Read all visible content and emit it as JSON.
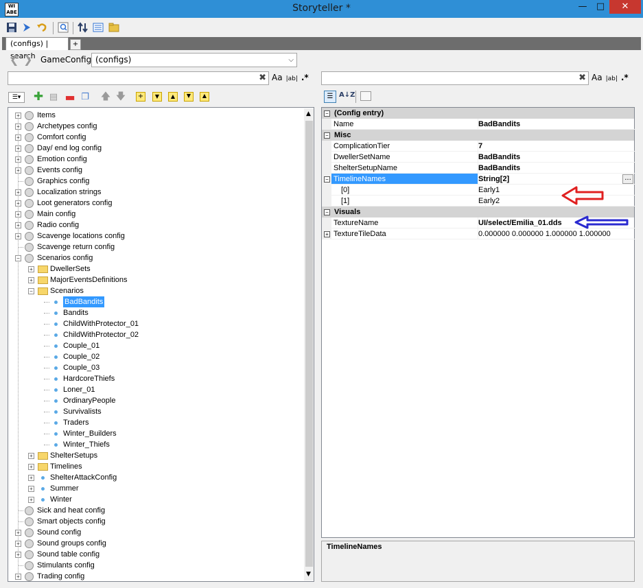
{
  "window": {
    "title": "Storyteller *",
    "app_icon_text": "WI\nABE"
  },
  "tabs": [
    {
      "label": "(configs) | search"
    }
  ],
  "tab_add_label": "+",
  "gameconfig": {
    "label": "GameConfig:",
    "value": "(configs)"
  },
  "search": {
    "left": {
      "value": "",
      "opts": [
        "Aa",
        "|ab|",
        ".*"
      ]
    },
    "right": {
      "value": "",
      "opts": [
        "Aa",
        "|ab|",
        ".*"
      ]
    }
  },
  "tree": [
    {
      "label": "Items",
      "icon": "gear",
      "expandable": true,
      "level": 0
    },
    {
      "label": "Archetypes config",
      "icon": "gear",
      "expandable": true,
      "level": 0
    },
    {
      "label": "Comfort config",
      "icon": "gear",
      "expandable": true,
      "level": 0
    },
    {
      "label": "Day/ end log config",
      "icon": "gear",
      "expandable": true,
      "level": 0
    },
    {
      "label": "Emotion config",
      "icon": "gear",
      "expandable": true,
      "level": 0
    },
    {
      "label": "Events config",
      "icon": "gear",
      "expandable": true,
      "level": 0
    },
    {
      "label": "Graphics config",
      "icon": "gear",
      "expandable": false,
      "level": 0
    },
    {
      "label": "Localization strings",
      "icon": "gear",
      "expandable": true,
      "level": 0
    },
    {
      "label": "Loot generators config",
      "icon": "gear",
      "expandable": true,
      "level": 0
    },
    {
      "label": "Main config",
      "icon": "gear",
      "expandable": true,
      "level": 0
    },
    {
      "label": "Radio config",
      "icon": "gear",
      "expandable": true,
      "level": 0
    },
    {
      "label": "Scavenge locations config",
      "icon": "gear",
      "expandable": true,
      "level": 0
    },
    {
      "label": "Scavenge return config",
      "icon": "gear",
      "expandable": false,
      "level": 0
    },
    {
      "label": "Scenarios config",
      "icon": "gear",
      "expandable": true,
      "expanded": true,
      "level": 0
    },
    {
      "label": "DwellerSets",
      "icon": "folder",
      "expandable": true,
      "level": 1
    },
    {
      "label": "MajorEventsDefinitions",
      "icon": "folder",
      "expandable": true,
      "level": 1
    },
    {
      "label": "Scenarios",
      "icon": "folder",
      "expandable": true,
      "expanded": true,
      "level": 1
    },
    {
      "label": "BadBandits",
      "icon": "dot",
      "expandable": false,
      "level": 2,
      "selected": true
    },
    {
      "label": "Bandits",
      "icon": "dot",
      "expandable": false,
      "level": 2
    },
    {
      "label": "ChildWithProtector_01",
      "icon": "dot",
      "expandable": false,
      "level": 2
    },
    {
      "label": "ChildWithProtector_02",
      "icon": "dot",
      "expandable": false,
      "level": 2
    },
    {
      "label": "Couple_01",
      "icon": "dot",
      "expandable": false,
      "level": 2
    },
    {
      "label": "Couple_02",
      "icon": "dot",
      "expandable": false,
      "level": 2
    },
    {
      "label": "Couple_03",
      "icon": "dot",
      "expandable": false,
      "level": 2
    },
    {
      "label": "HardcoreThiefs",
      "icon": "dot",
      "expandable": false,
      "level": 2
    },
    {
      "label": "Loner_01",
      "icon": "dot",
      "expandable": false,
      "level": 2
    },
    {
      "label": "OrdinaryPeople",
      "icon": "dot",
      "expandable": false,
      "level": 2
    },
    {
      "label": "Survivalists",
      "icon": "dot",
      "expandable": false,
      "level": 2
    },
    {
      "label": "Traders",
      "icon": "dot",
      "expandable": false,
      "level": 2
    },
    {
      "label": "Winter_Builders",
      "icon": "dot",
      "expandable": false,
      "level": 2
    },
    {
      "label": "Winter_Thiefs",
      "icon": "dot",
      "expandable": false,
      "level": 2
    },
    {
      "label": "ShelterSetups",
      "icon": "folder",
      "expandable": true,
      "level": 1
    },
    {
      "label": "Timelines",
      "icon": "folder",
      "expandable": true,
      "level": 1
    },
    {
      "label": "ShelterAttackConfig",
      "icon": "dot",
      "expandable": true,
      "level": 1
    },
    {
      "label": "Summer",
      "icon": "dot",
      "expandable": true,
      "level": 1
    },
    {
      "label": "Winter",
      "icon": "dot",
      "expandable": true,
      "level": 1
    },
    {
      "label": "Sick and heat config",
      "icon": "gear",
      "expandable": false,
      "level": 0
    },
    {
      "label": "Smart objects config",
      "icon": "gear",
      "expandable": false,
      "level": 0
    },
    {
      "label": "Sound config",
      "icon": "gear",
      "expandable": true,
      "level": 0
    },
    {
      "label": "Sound groups config",
      "icon": "gear",
      "expandable": true,
      "level": 0
    },
    {
      "label": "Sound table config",
      "icon": "gear",
      "expandable": true,
      "level": 0
    },
    {
      "label": "Stimulants config",
      "icon": "gear",
      "expandable": false,
      "level": 0
    },
    {
      "label": "Trading config",
      "icon": "gear",
      "expandable": true,
      "level": 0
    }
  ],
  "properties": [
    {
      "type": "category",
      "name": "(Config entry)"
    },
    {
      "type": "prop",
      "name": "Name",
      "value": "BadBandits",
      "bold": true
    },
    {
      "type": "category",
      "name": "Misc"
    },
    {
      "type": "prop",
      "name": "ComplicationTier",
      "value": "7",
      "bold": true
    },
    {
      "type": "prop",
      "name": "DwellerSetName",
      "value": "BadBandits",
      "bold": true
    },
    {
      "type": "prop",
      "name": "ShelterSetupName",
      "value": "BadBandits",
      "bold": true
    },
    {
      "type": "prop",
      "name": "TimelineNames",
      "value": "String[2]",
      "bold": true,
      "selected": true,
      "collapsible": true,
      "ellipsis": "..."
    },
    {
      "type": "prop",
      "name": "[0]",
      "value": "Early1",
      "indent": true
    },
    {
      "type": "prop",
      "name": "[1]",
      "value": "Early2",
      "indent": true
    },
    {
      "type": "category",
      "name": "Visuals"
    },
    {
      "type": "prop",
      "name": "TextureName",
      "value": "UI/select/Emilia_01.dds",
      "bold": true
    },
    {
      "type": "prop",
      "name": "TextureTileData",
      "value": "0.000000 0.000000 1.000000 1.000000",
      "expandable": true
    }
  ],
  "description": {
    "title": "TimelineNames"
  },
  "colors": {
    "title_bar": "#2f8fd6",
    "selection": "#3399ff",
    "annotation_red": "#e02020",
    "annotation_blue": "#2a2ad0"
  }
}
